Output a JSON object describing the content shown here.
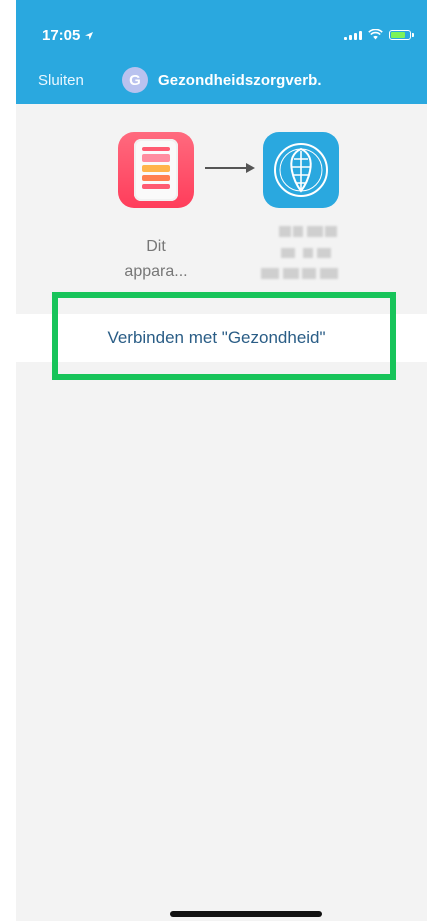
{
  "status_bar": {
    "time": "17:05",
    "location_icon": "location-arrow-icon",
    "signal_icon": "signal-icon",
    "wifi_icon": "wifi-icon",
    "battery_icon": "battery-charging-icon"
  },
  "nav": {
    "close_label": "Sluiten",
    "avatar_initial": "G",
    "title": "Gezondheidszorgverb."
  },
  "connection": {
    "source_app_icon": "health-app-icon",
    "arrow_icon": "arrow-right-icon",
    "target_app_icon": "radboud-app-icon",
    "source_label_line1": "Dit",
    "source_label_line2": "appara..."
  },
  "action": {
    "connect_label": "Verbinden met \"Gezondheid\""
  },
  "colors": {
    "header": "#2aa8df",
    "highlight": "#17c45a",
    "link": "#2a5d86"
  }
}
